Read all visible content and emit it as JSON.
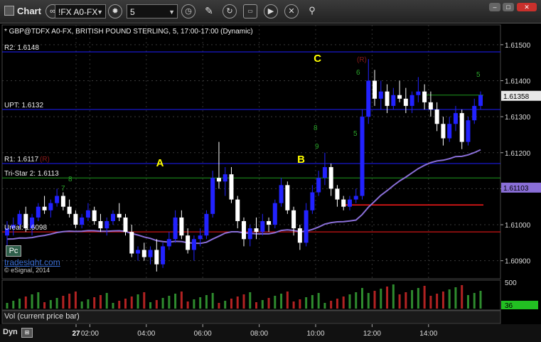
{
  "window": {
    "title": "Chart"
  },
  "toolbar": {
    "symbol": "!FX A0-FX",
    "interval": "5",
    "icons": [
      "link-icon",
      "settings-icon",
      "clock-icon",
      "pencil-icon",
      "refresh-icon",
      "image-icon",
      "play-icon",
      "close-icon",
      "pin-icon"
    ]
  },
  "chart": {
    "header": "* GBP@TDFX A0-FX, BRITISH POUND STERLING, 5, 17:00-17:00 (Dynamic)",
    "copyright": "© eSignal, 2014",
    "watermark": "tradesight.com",
    "pc_label": "Pc",
    "vol_label": "Vol (current price bar)",
    "dyn_label": "Dyn",
    "colors": {
      "up": "#2222ff",
      "down": "#ffffff",
      "level": "#1e1eff",
      "red": "#ff1a1a",
      "ma": "#8a6fd8",
      "green_line": "#1e9a1e",
      "annot": "#ffff00"
    }
  },
  "chart_data": {
    "type": "candlestick",
    "title": "* GBP@TDFX A0-FX, BRITISH POUND STERLING, 5, 17:00-17:00 (Dynamic)",
    "price_axis": {
      "ylim": [
        1.6085,
        1.6155
      ],
      "ticks": [
        "1.61500",
        "1.61400",
        "1.61300",
        "1.61200",
        "1.61100",
        "1.61000",
        "1.60900"
      ]
    },
    "time_axis": {
      "ticks": [
        "27",
        "02:00",
        "04:00",
        "06:00",
        "08:00",
        "10:00",
        "12:00",
        "14:00"
      ]
    },
    "levels": [
      {
        "label": "R2: 1.6148",
        "value": 1.6148
      },
      {
        "label": "UPT: 1.6132",
        "value": 1.6132
      },
      {
        "label": "R1: 1.6117",
        "value": 1.6117
      },
      {
        "label": "Tri-Star 2: 1.6113",
        "value": 1.6113
      },
      {
        "label": "Ureal: 1.6098",
        "value": 1.6098
      }
    ],
    "r_marker": "(R)",
    "annotations": [
      {
        "text": "A",
        "time": "04:30",
        "price": 1.6117
      },
      {
        "text": "B",
        "time": "09:30",
        "price": 1.6118
      },
      {
        "text": "C",
        "time": "10:05",
        "price": 1.6146
      }
    ],
    "last_price": "1.61358",
    "ma_last": "1.61103",
    "volume_axis": {
      "ticks": [
        "500"
      ],
      "current": "36"
    },
    "seq_labels": [
      "8",
      "9",
      "5",
      "6",
      "5",
      "7",
      "8"
    ],
    "candles_ohlc": [
      [
        1.6097,
        1.6101,
        1.6094,
        1.6099
      ],
      [
        1.6099,
        1.6102,
        1.6097,
        1.61
      ],
      [
        1.61,
        1.6104,
        1.6099,
        1.6103
      ],
      [
        1.6103,
        1.6105,
        1.6098,
        1.6099
      ],
      [
        1.6099,
        1.6103,
        1.6097,
        1.6102
      ],
      [
        1.6102,
        1.6106,
        1.6101,
        1.6105
      ],
      [
        1.6105,
        1.6108,
        1.6103,
        1.6104
      ],
      [
        1.6104,
        1.6107,
        1.6102,
        1.6106
      ],
      [
        1.6106,
        1.611,
        1.6105,
        1.6108
      ],
      [
        1.6108,
        1.6109,
        1.6104,
        1.6105
      ],
      [
        1.6105,
        1.6107,
        1.6102,
        1.6103
      ],
      [
        1.6103,
        1.6104,
        1.6099,
        1.61
      ],
      [
        1.61,
        1.6103,
        1.6099,
        1.6102
      ],
      [
        1.6102,
        1.6106,
        1.6101,
        1.6104
      ],
      [
        1.6104,
        1.6105,
        1.61,
        1.6101
      ],
      [
        1.6101,
        1.6103,
        1.6098,
        1.6099
      ],
      [
        1.6099,
        1.6102,
        1.6097,
        1.6101
      ],
      [
        1.6101,
        1.6104,
        1.61,
        1.6103
      ],
      [
        1.6103,
        1.6106,
        1.6101,
        1.6102
      ],
      [
        1.6102,
        1.6103,
        1.6097,
        1.6098
      ],
      [
        1.6098,
        1.61,
        1.6091,
        1.6092
      ],
      [
        1.6092,
        1.6094,
        1.609,
        1.6093
      ],
      [
        1.6093,
        1.6095,
        1.609,
        1.6091
      ],
      [
        1.6091,
        1.6094,
        1.6089,
        1.6093
      ],
      [
        1.6093,
        1.6096,
        1.6087,
        1.6089
      ],
      [
        1.6089,
        1.6095,
        1.6088,
        1.6094
      ],
      [
        1.6094,
        1.6098,
        1.6093,
        1.6096
      ],
      [
        1.6096,
        1.6104,
        1.6095,
        1.6102
      ],
      [
        1.6102,
        1.6104,
        1.6096,
        1.6097
      ],
      [
        1.6097,
        1.6099,
        1.6092,
        1.6093
      ],
      [
        1.6093,
        1.6097,
        1.609,
        1.6096
      ],
      [
        1.6096,
        1.6099,
        1.6094,
        1.6097
      ],
      [
        1.6097,
        1.6104,
        1.6096,
        1.6103
      ],
      [
        1.6103,
        1.6115,
        1.6102,
        1.6113
      ],
      [
        1.6113,
        1.6123,
        1.611,
        1.6112
      ],
      [
        1.6112,
        1.6116,
        1.6108,
        1.6114
      ],
      [
        1.6114,
        1.6116,
        1.6106,
        1.6107
      ],
      [
        1.6107,
        1.6108,
        1.6099,
        1.6101
      ],
      [
        1.6101,
        1.6102,
        1.6094,
        1.6096
      ],
      [
        1.6096,
        1.61,
        1.6094,
        1.6099
      ],
      [
        1.6099,
        1.6102,
        1.6096,
        1.6098
      ],
      [
        1.6098,
        1.6103,
        1.6097,
        1.6101
      ],
      [
        1.6101,
        1.6102,
        1.6098,
        1.61
      ],
      [
        1.61,
        1.6107,
        1.6099,
        1.6106
      ],
      [
        1.6106,
        1.6113,
        1.6105,
        1.6111
      ],
      [
        1.6111,
        1.6112,
        1.6103,
        1.6104
      ],
      [
        1.6104,
        1.6105,
        1.6097,
        1.6099
      ],
      [
        1.6099,
        1.61,
        1.6093,
        1.6095
      ],
      [
        1.6095,
        1.6106,
        1.6094,
        1.6104
      ],
      [
        1.6104,
        1.6111,
        1.6103,
        1.6109
      ],
      [
        1.6109,
        1.6115,
        1.6108,
        1.6113
      ],
      [
        1.6113,
        1.612,
        1.6111,
        1.6116
      ],
      [
        1.6116,
        1.6117,
        1.6108,
        1.611
      ],
      [
        1.611,
        1.6111,
        1.6105,
        1.6107
      ],
      [
        1.6107,
        1.6108,
        1.6104,
        1.6105
      ],
      [
        1.6105,
        1.6108,
        1.6104,
        1.6107
      ],
      [
        1.6107,
        1.611,
        1.6106,
        1.6108
      ],
      [
        1.6108,
        1.6132,
        1.6107,
        1.613
      ],
      [
        1.613,
        1.6146,
        1.6128,
        1.614
      ],
      [
        1.614,
        1.6143,
        1.6133,
        1.6135
      ],
      [
        1.6135,
        1.614,
        1.6132,
        1.6137
      ],
      [
        1.6137,
        1.6139,
        1.6131,
        1.6133
      ],
      [
        1.6133,
        1.6138,
        1.6132,
        1.6136
      ],
      [
        1.6136,
        1.614,
        1.6134,
        1.6135
      ],
      [
        1.6135,
        1.6138,
        1.6131,
        1.6133
      ],
      [
        1.6133,
        1.6137,
        1.6131,
        1.6136
      ],
      [
        1.6136,
        1.6141,
        1.6134,
        1.6137
      ],
      [
        1.6137,
        1.6139,
        1.6132,
        1.6134
      ],
      [
        1.6134,
        1.6137,
        1.613,
        1.6132
      ],
      [
        1.6132,
        1.6134,
        1.6126,
        1.6128
      ],
      [
        1.6128,
        1.613,
        1.6122,
        1.6124
      ],
      [
        1.6124,
        1.613,
        1.6123,
        1.6128
      ],
      [
        1.6128,
        1.6133,
        1.6126,
        1.6131
      ],
      [
        1.6131,
        1.6132,
        1.6121,
        1.6123
      ],
      [
        1.6123,
        1.613,
        1.6122,
        1.6129
      ],
      [
        1.6129,
        1.6135,
        1.6128,
        1.6133
      ],
      [
        1.6133,
        1.6137,
        1.6132,
        1.6136
      ]
    ]
  }
}
